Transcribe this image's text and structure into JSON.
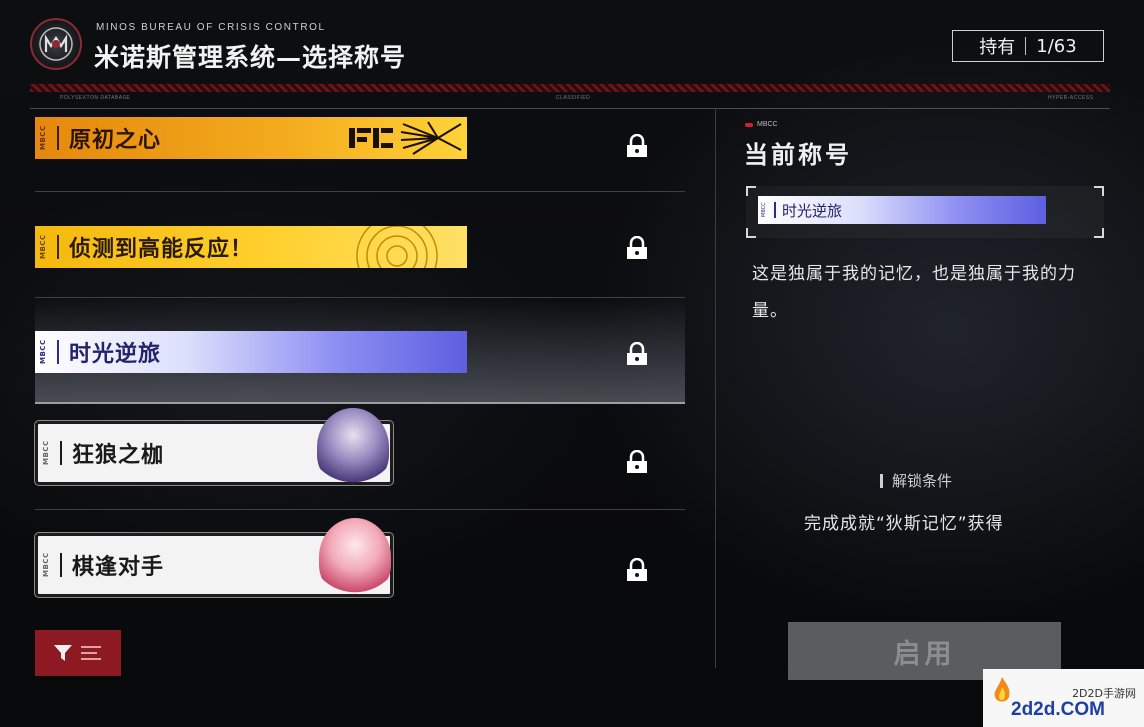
{
  "header": {
    "brand_sub": "MINOS BUREAU OF  CRISIS CONTROL",
    "title": "米诺斯管理系统—选择称号",
    "owned_label": "持有",
    "owned_count": "1/63",
    "micro_left": "POLYSEXTON DATABASE",
    "micro_center": "CLASSIFIED",
    "micro_right": "HYPER-ACCESS"
  },
  "titles": [
    {
      "name": "原初之心",
      "style": "orange",
      "mark": "MBCC",
      "locked": true,
      "icon": "lock-icon"
    },
    {
      "name": "侦测到高能反应！",
      "style": "yellow",
      "mark": "MBCC",
      "locked": true,
      "icon": "lock-icon"
    },
    {
      "name": "时光逆旅",
      "style": "blue",
      "mark": "MBCC",
      "locked": true,
      "selected": true,
      "icon": "lock-icon"
    },
    {
      "name": "狂狼之枷",
      "style": "white",
      "mark": "MBCC",
      "locked": true,
      "icon": "lock-icon"
    },
    {
      "name": "棋逢对手",
      "style": "white",
      "mark": "MBCC",
      "locked": true,
      "icon": "lock-icon"
    }
  ],
  "current": {
    "badge": "MBCC",
    "heading": "当前称号",
    "tag_name": "时光逆旅",
    "tag_mark": "MBCC",
    "description": "这是独属于我的记忆，也是独属于我的力量。",
    "unlock_heading": "解锁条件",
    "unlock_text": "完成成就“狄斯记忆”获得",
    "enable_label": "启用"
  },
  "filter": {
    "icon": "filter-icon"
  },
  "watermark": {
    "cn": "2D2D手游网",
    "en": "2d2d.COM"
  },
  "colors": {
    "accent_red": "#8d1a22",
    "lock": "#ffffff"
  }
}
